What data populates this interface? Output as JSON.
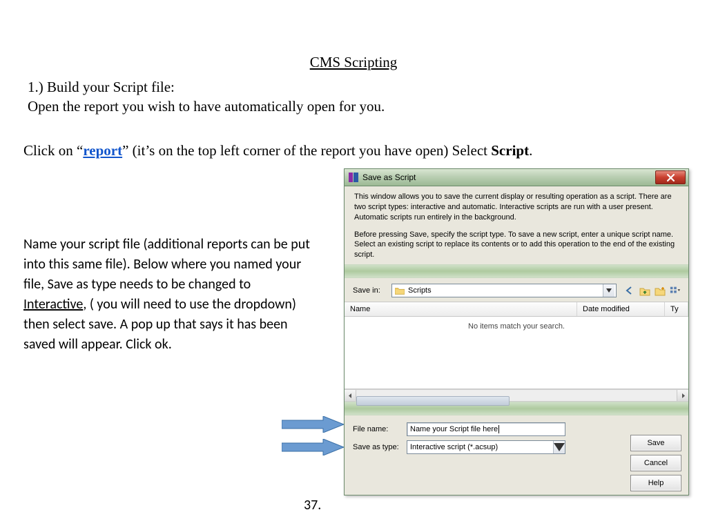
{
  "title": "CMS Scripting",
  "step1_line1": "1.) Build your Script file:",
  "step1_line2": "Open the report you wish to have automatically open for you.",
  "click_prefix": "Click on “",
  "click_link": "report",
  "click_mid": "” (it’s on the top left corner of the report you have open) Select ",
  "click_bold": "Script",
  "click_suffix": ".",
  "sidetext_a": "Name your script file (additional reports can be put into this same file).  Below where you named your file, Save as type needs to be changed to ",
  "sidetext_ul": "Interactive",
  "sidetext_b": ", ( you will need to use the dropdown) then select save. A pop up that says it has been saved will appear. Click ok.",
  "page_number": "37.",
  "dialog": {
    "title": "Save as Script",
    "desc_p1": "This window allows you to save the current display or resulting operation as a script. There are two script types:  interactive and automatic.  Interactive scripts are run with a user present.  Automatic scripts run entirely in the background.",
    "desc_p2": "Before pressing Save, specify the script type.  To save a new script, enter a unique script name.  Select an existing script to replace its contents or to add this operation to the end of the existing script.",
    "savein_label": "Save in:",
    "savein_value": "Scripts",
    "col_name": "Name",
    "col_date": "Date modified",
    "col_type": "Ty",
    "empty_msg": "No items match your search.",
    "filename_label": "File name:",
    "filename_value": "Name your Script file here",
    "saveastype_label": "Save as type:",
    "saveastype_value": "Interactive script (*.acsup)",
    "btn_save": "Save",
    "btn_cancel": "Cancel",
    "btn_help": "Help"
  }
}
